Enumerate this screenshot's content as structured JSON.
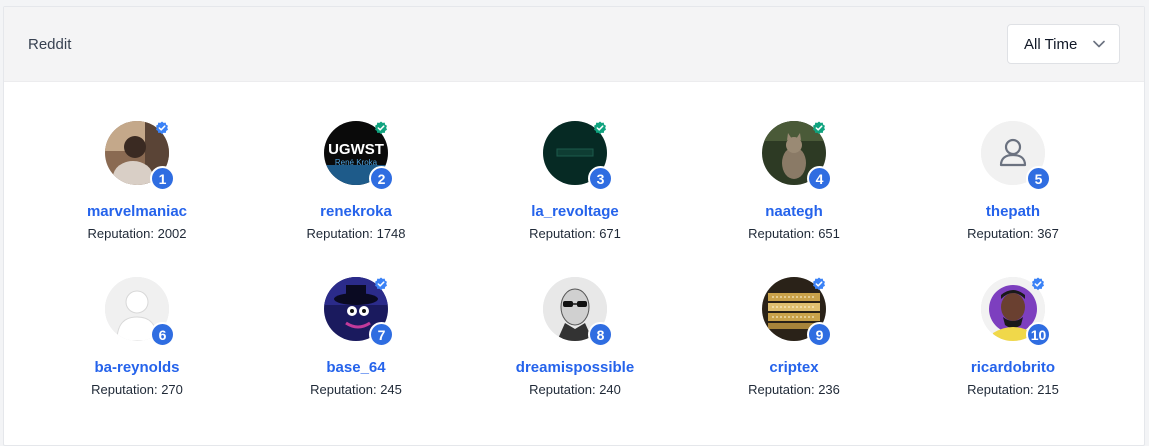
{
  "header": {
    "title": "Reddit",
    "period_select": {
      "value": "All Time",
      "icon": "chevron-down-icon"
    }
  },
  "colors": {
    "rank_badge": "#2f6de1",
    "username": "#2563eb",
    "verified_blue": "#3b82f6",
    "verified_green": "#10a37f"
  },
  "reputation_label": "Reputation:",
  "users": [
    {
      "rank": "1",
      "name": "marvelmaniac",
      "reputation": "Reputation: 2002",
      "verified": "blue",
      "avatar": "photo-person"
    },
    {
      "rank": "2",
      "name": "renekroka",
      "reputation": "Reputation: 1748",
      "verified": "green",
      "avatar": "logo-ugwst",
      "avatar_text": "UGWST",
      "avatar_subtext": "René Kroka"
    },
    {
      "rank": "3",
      "name": "la_revoltage",
      "reputation": "Reputation: 671",
      "verified": "green",
      "avatar": "dark-green"
    },
    {
      "rank": "4",
      "name": "naategh",
      "reputation": "Reputation: 651",
      "verified": "green",
      "avatar": "photo-cat"
    },
    {
      "rank": "5",
      "name": "thepath",
      "reputation": "Reputation: 367",
      "verified": "none",
      "avatar": "user-placeholder-icon"
    },
    {
      "rank": "6",
      "name": "ba-reynolds",
      "reputation": "Reputation: 270",
      "verified": "none",
      "avatar": "silhouette-placeholder"
    },
    {
      "rank": "7",
      "name": "base_64",
      "reputation": "Reputation: 245",
      "verified": "blue",
      "avatar": "illustration-hat"
    },
    {
      "rank": "8",
      "name": "dreamispossible",
      "reputation": "Reputation: 240",
      "verified": "none",
      "avatar": "sketch-sunglasses"
    },
    {
      "rank": "9",
      "name": "criptex",
      "reputation": "Reputation: 236",
      "verified": "blue",
      "avatar": "photo-cryptex"
    },
    {
      "rank": "10",
      "name": "ricardobrito",
      "reputation": "Reputation: 215",
      "verified": "blue",
      "avatar": "cartoon-person"
    }
  ]
}
